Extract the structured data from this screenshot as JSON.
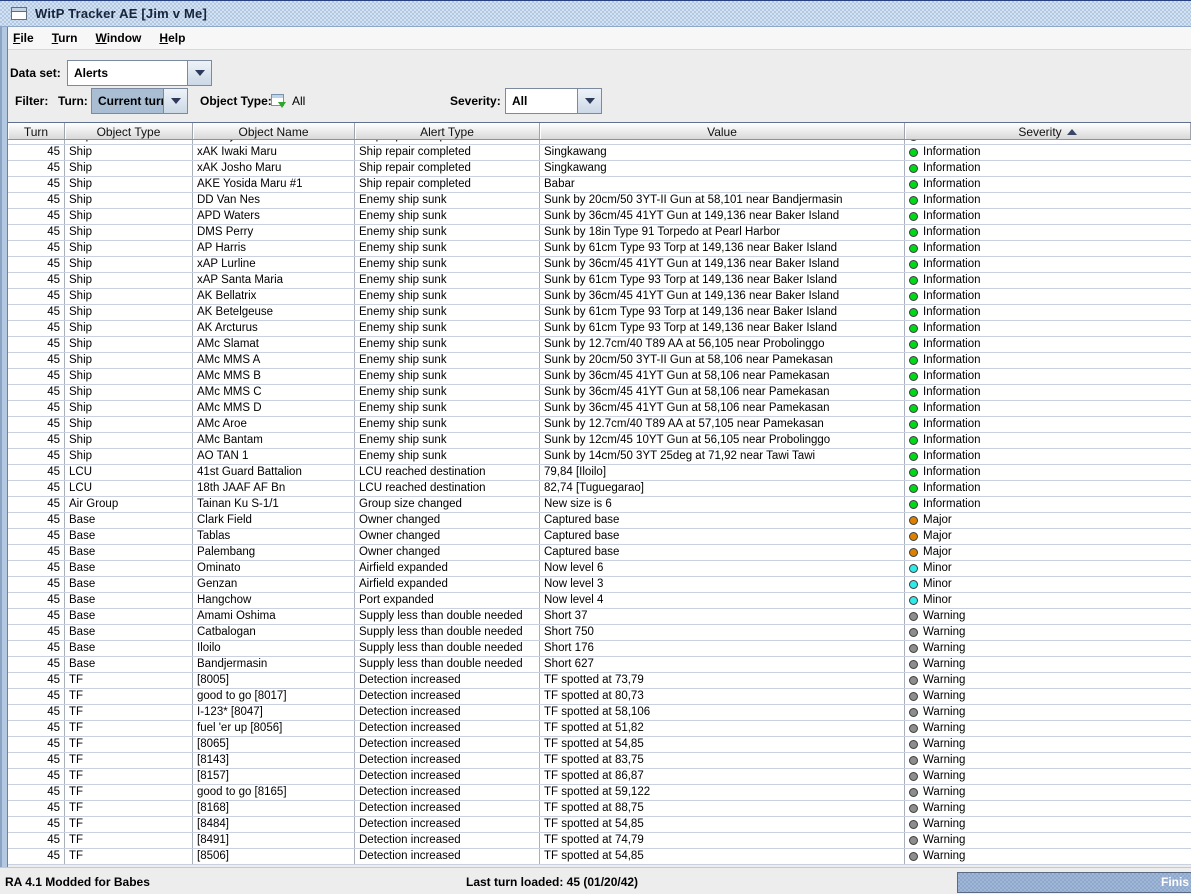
{
  "window": {
    "title": "WitP Tracker AE [Jim v Me]"
  },
  "menu": {
    "items": [
      {
        "mnemonic": "F",
        "rest": "ile"
      },
      {
        "mnemonic": "T",
        "rest": "urn"
      },
      {
        "mnemonic": "W",
        "rest": "indow"
      },
      {
        "mnemonic": "H",
        "rest": "elp"
      }
    ]
  },
  "toolbar": {
    "data_set_label": "Data set:",
    "data_set_value": "Alerts",
    "filter_label": "Filter:",
    "turn_label": "Turn:",
    "turn_value": "Current turn",
    "object_type_label": "Object Type:",
    "object_type_value": "All",
    "severity_label": "Severity:",
    "severity_value": "All"
  },
  "table": {
    "columns": [
      {
        "label": "Turn"
      },
      {
        "label": "Object Type"
      },
      {
        "label": "Object Name"
      },
      {
        "label": "Alert Type"
      },
      {
        "label": "Value"
      },
      {
        "label": "Severity",
        "sorted": "asc"
      }
    ],
    "partial_row": {
      "turn": "45",
      "object_type": "Ship",
      "object_name": "xAK Hyo Maru",
      "alert_type": "Ship repair completed",
      "value": "Akita",
      "severity": "Information"
    },
    "rows": [
      {
        "turn": "45",
        "object_type": "Ship",
        "object_name": "xAK Iwaki Maru",
        "alert_type": "Ship repair completed",
        "value": "Singkawang",
        "severity": "Information"
      },
      {
        "turn": "45",
        "object_type": "Ship",
        "object_name": "xAK Josho Maru",
        "alert_type": "Ship repair completed",
        "value": "Singkawang",
        "severity": "Information"
      },
      {
        "turn": "45",
        "object_type": "Ship",
        "object_name": "AKE Yosida Maru #1",
        "alert_type": "Ship repair completed",
        "value": "Babar",
        "severity": "Information"
      },
      {
        "turn": "45",
        "object_type": "Ship",
        "object_name": "DD Van Nes",
        "alert_type": "Enemy ship sunk",
        "value": "Sunk by 20cm/50 3YT-II Gun at 58,101 near Bandjermasin",
        "severity": "Information"
      },
      {
        "turn": "45",
        "object_type": "Ship",
        "object_name": "APD Waters",
        "alert_type": "Enemy ship sunk",
        "value": "Sunk by 36cm/45 41YT Gun at 149,136 near Baker Island",
        "severity": "Information"
      },
      {
        "turn": "45",
        "object_type": "Ship",
        "object_name": "DMS Perry",
        "alert_type": "Enemy ship sunk",
        "value": "Sunk by 18in Type 91 Torpedo at Pearl Harbor",
        "severity": "Information"
      },
      {
        "turn": "45",
        "object_type": "Ship",
        "object_name": "AP Harris",
        "alert_type": "Enemy ship sunk",
        "value": "Sunk by 61cm Type 93 Torp at 149,136 near Baker Island",
        "severity": "Information"
      },
      {
        "turn": "45",
        "object_type": "Ship",
        "object_name": "xAP Lurline",
        "alert_type": "Enemy ship sunk",
        "value": "Sunk by 36cm/45 41YT Gun at 149,136 near Baker Island",
        "severity": "Information"
      },
      {
        "turn": "45",
        "object_type": "Ship",
        "object_name": "xAP Santa Maria",
        "alert_type": "Enemy ship sunk",
        "value": "Sunk by 61cm Type 93 Torp at 149,136 near Baker Island",
        "severity": "Information"
      },
      {
        "turn": "45",
        "object_type": "Ship",
        "object_name": "AK Bellatrix",
        "alert_type": "Enemy ship sunk",
        "value": "Sunk by 36cm/45 41YT Gun at 149,136 near Baker Island",
        "severity": "Information"
      },
      {
        "turn": "45",
        "object_type": "Ship",
        "object_name": "AK Betelgeuse",
        "alert_type": "Enemy ship sunk",
        "value": "Sunk by 61cm Type 93 Torp at 149,136 near Baker Island",
        "severity": "Information"
      },
      {
        "turn": "45",
        "object_type": "Ship",
        "object_name": "AK Arcturus",
        "alert_type": "Enemy ship sunk",
        "value": "Sunk by 61cm Type 93 Torp at 149,136 near Baker Island",
        "severity": "Information"
      },
      {
        "turn": "45",
        "object_type": "Ship",
        "object_name": "AMc Slamat",
        "alert_type": "Enemy ship sunk",
        "value": "Sunk by 12.7cm/40 T89 AA at 56,105 near Probolinggo",
        "severity": "Information"
      },
      {
        "turn": "45",
        "object_type": "Ship",
        "object_name": "AMc MMS A",
        "alert_type": "Enemy ship sunk",
        "value": "Sunk by 20cm/50 3YT-II Gun at 58,106 near Pamekasan",
        "severity": "Information"
      },
      {
        "turn": "45",
        "object_type": "Ship",
        "object_name": "AMc MMS B",
        "alert_type": "Enemy ship sunk",
        "value": "Sunk by 36cm/45 41YT Gun at 58,106 near Pamekasan",
        "severity": "Information"
      },
      {
        "turn": "45",
        "object_type": "Ship",
        "object_name": "AMc MMS C",
        "alert_type": "Enemy ship sunk",
        "value": "Sunk by 36cm/45 41YT Gun at 58,106 near Pamekasan",
        "severity": "Information"
      },
      {
        "turn": "45",
        "object_type": "Ship",
        "object_name": "AMc MMS D",
        "alert_type": "Enemy ship sunk",
        "value": "Sunk by 36cm/45 41YT Gun at 58,106 near Pamekasan",
        "severity": "Information"
      },
      {
        "turn": "45",
        "object_type": "Ship",
        "object_name": "AMc Aroe",
        "alert_type": "Enemy ship sunk",
        "value": "Sunk by 12.7cm/40 T89 AA at 57,105 near Pamekasan",
        "severity": "Information"
      },
      {
        "turn": "45",
        "object_type": "Ship",
        "object_name": "AMc Bantam",
        "alert_type": "Enemy ship sunk",
        "value": "Sunk by 12cm/45 10YT Gun at 56,105 near Probolinggo",
        "severity": "Information"
      },
      {
        "turn": "45",
        "object_type": "Ship",
        "object_name": "AO TAN 1",
        "alert_type": "Enemy ship sunk",
        "value": "Sunk by 14cm/50 3YT 25deg at 71,92 near Tawi Tawi",
        "severity": "Information"
      },
      {
        "turn": "45",
        "object_type": "LCU",
        "object_name": "41st Guard Battalion",
        "alert_type": "LCU reached destination",
        "value": "79,84 [Iloilo]",
        "severity": "Information"
      },
      {
        "turn": "45",
        "object_type": "LCU",
        "object_name": "18th JAAF AF Bn",
        "alert_type": "LCU reached destination",
        "value": "82,74 [Tuguegarao]",
        "severity": "Information"
      },
      {
        "turn": "45",
        "object_type": "Air Group",
        "object_name": "Tainan Ku S-1/1",
        "alert_type": "Group size changed",
        "value": "New size is 6",
        "severity": "Information"
      },
      {
        "turn": "45",
        "object_type": "Base",
        "object_name": "Clark Field",
        "alert_type": "Owner changed",
        "value": "Captured base",
        "severity": "Major"
      },
      {
        "turn": "45",
        "object_type": "Base",
        "object_name": "Tablas",
        "alert_type": "Owner changed",
        "value": "Captured base",
        "severity": "Major"
      },
      {
        "turn": "45",
        "object_type": "Base",
        "object_name": "Palembang",
        "alert_type": "Owner changed",
        "value": "Captured base",
        "severity": "Major"
      },
      {
        "turn": "45",
        "object_type": "Base",
        "object_name": "Ominato",
        "alert_type": "Airfield expanded",
        "value": "Now level 6",
        "severity": "Minor"
      },
      {
        "turn": "45",
        "object_type": "Base",
        "object_name": "Genzan",
        "alert_type": "Airfield expanded",
        "value": "Now level 3",
        "severity": "Minor"
      },
      {
        "turn": "45",
        "object_type": "Base",
        "object_name": "Hangchow",
        "alert_type": "Port expanded",
        "value": "Now level 4",
        "severity": "Minor"
      },
      {
        "turn": "45",
        "object_type": "Base",
        "object_name": "Amami Oshima",
        "alert_type": "Supply less than double needed",
        "value": "Short 37",
        "severity": "Warning"
      },
      {
        "turn": "45",
        "object_type": "Base",
        "object_name": "Catbalogan",
        "alert_type": "Supply less than double needed",
        "value": "Short 750",
        "severity": "Warning"
      },
      {
        "turn": "45",
        "object_type": "Base",
        "object_name": "Iloilo",
        "alert_type": "Supply less than double needed",
        "value": "Short 176",
        "severity": "Warning"
      },
      {
        "turn": "45",
        "object_type": "Base",
        "object_name": "Bandjermasin",
        "alert_type": "Supply less than double needed",
        "value": "Short 627",
        "severity": "Warning"
      },
      {
        "turn": "45",
        "object_type": "TF",
        "object_name": "[8005]",
        "alert_type": "Detection increased",
        "value": "TF spotted at 73,79",
        "severity": "Warning"
      },
      {
        "turn": "45",
        "object_type": "TF",
        "object_name": "good to go [8017]",
        "alert_type": "Detection increased",
        "value": "TF spotted at 80,73",
        "severity": "Warning"
      },
      {
        "turn": "45",
        "object_type": "TF",
        "object_name": "I-123* [8047]",
        "alert_type": "Detection increased",
        "value": "TF spotted at 58,106",
        "severity": "Warning"
      },
      {
        "turn": "45",
        "object_type": "TF",
        "object_name": "fuel 'er up [8056]",
        "alert_type": "Detection increased",
        "value": "TF spotted at 51,82",
        "severity": "Warning"
      },
      {
        "turn": "45",
        "object_type": "TF",
        "object_name": "[8065]",
        "alert_type": "Detection increased",
        "value": "TF spotted at 54,85",
        "severity": "Warning"
      },
      {
        "turn": "45",
        "object_type": "TF",
        "object_name": "[8143]",
        "alert_type": "Detection increased",
        "value": "TF spotted at 83,75",
        "severity": "Warning"
      },
      {
        "turn": "45",
        "object_type": "TF",
        "object_name": "[8157]",
        "alert_type": "Detection increased",
        "value": "TF spotted at 86,87",
        "severity": "Warning"
      },
      {
        "turn": "45",
        "object_type": "TF",
        "object_name": "good to go [8165]",
        "alert_type": "Detection increased",
        "value": "TF spotted at 59,122",
        "severity": "Warning"
      },
      {
        "turn": "45",
        "object_type": "TF",
        "object_name": "[8168]",
        "alert_type": "Detection increased",
        "value": "TF spotted at 88,75",
        "severity": "Warning"
      },
      {
        "turn": "45",
        "object_type": "TF",
        "object_name": "[8484]",
        "alert_type": "Detection increased",
        "value": "TF spotted at 54,85",
        "severity": "Warning"
      },
      {
        "turn": "45",
        "object_type": "TF",
        "object_name": "[8491]",
        "alert_type": "Detection increased",
        "value": "TF spotted at 74,79",
        "severity": "Warning"
      },
      {
        "turn": "45",
        "object_type": "TF",
        "object_name": "[8506]",
        "alert_type": "Detection increased",
        "value": "TF spotted at 54,85",
        "severity": "Warning"
      }
    ]
  },
  "severity_colors": {
    "Information": "#00d81a",
    "Major": "#dd8200",
    "Minor": "#2eeaea",
    "Warning": "#8d8d8d"
  },
  "status_bar": {
    "left": "RA 4.1 Modded for Babes",
    "center": "Last turn loaded: 45 (01/20/42)",
    "progress_text": "Finis",
    "progress_color": "#8ea9cd"
  }
}
